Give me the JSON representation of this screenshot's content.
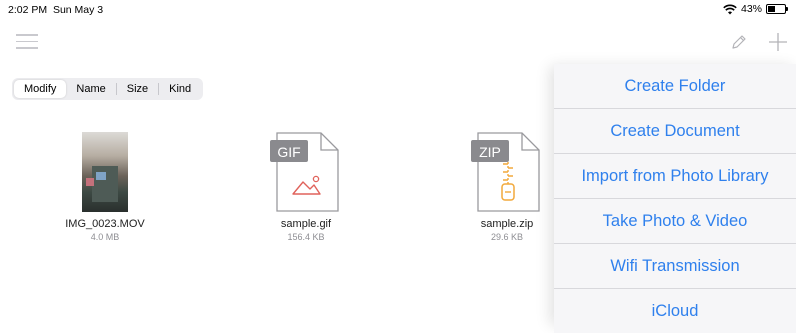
{
  "status_bar": {
    "time": "2:02 PM",
    "date": "Sun May 3",
    "battery": "43%",
    "battery_level": 0.43
  },
  "nav_bar": {
    "menu_icon": "hamburger-menu-icon",
    "edit_icon": "pencil-icon",
    "add_icon": "plus-icon"
  },
  "sort": {
    "tabs": [
      "Modify",
      "Name",
      "Size",
      "Kind"
    ],
    "selected": "Modify"
  },
  "files": [
    {
      "name": "IMG_0023.MOV",
      "size": "4.0 MB",
      "icon": "video-thumbnail"
    },
    {
      "name": "sample.gif",
      "size": "156.4 KB",
      "icon": "gif-file-icon",
      "badge": "GIF"
    },
    {
      "name": "sample.zip",
      "size": "29.6 KB",
      "icon": "zip-file-icon",
      "badge": "ZIP"
    }
  ],
  "menu": {
    "items": [
      "Create Folder",
      "Create Document",
      "Import from Photo Library",
      "Take Photo & Video",
      "Wifi Transmission",
      "iCloud"
    ]
  },
  "colors": {
    "accent": "#2f80ed",
    "gif_accent": "#e0625b",
    "zip_accent": "#f2a93b",
    "badge_bg": "#8a8a8e"
  }
}
